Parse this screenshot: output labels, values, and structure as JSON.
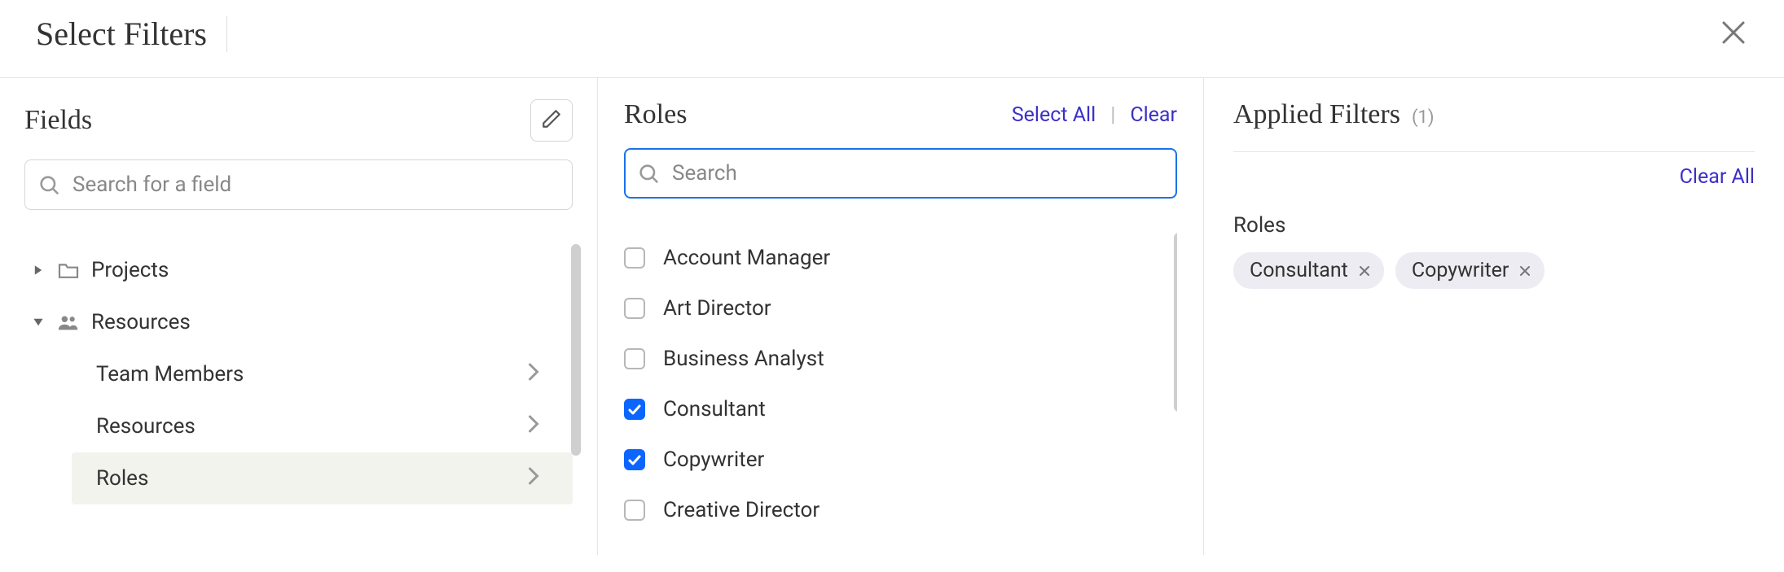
{
  "header": {
    "title": "Select Filters"
  },
  "fields": {
    "title": "Fields",
    "search_placeholder": "Search for a field",
    "tree": {
      "projects": {
        "label": "Projects"
      },
      "resources": {
        "label": "Resources",
        "children": [
          {
            "label": "Team Members",
            "selected": false
          },
          {
            "label": "Resources",
            "selected": false
          },
          {
            "label": "Roles",
            "selected": true
          }
        ]
      }
    }
  },
  "roles": {
    "title": "Roles",
    "select_all_label": "Select All",
    "clear_label": "Clear",
    "search_placeholder": "Search",
    "items": [
      {
        "label": "Account Manager",
        "checked": false
      },
      {
        "label": "Art Director",
        "checked": false
      },
      {
        "label": "Business Analyst",
        "checked": false
      },
      {
        "label": "Consultant",
        "checked": true
      },
      {
        "label": "Copywriter",
        "checked": true
      },
      {
        "label": "Creative Director",
        "checked": false
      }
    ]
  },
  "applied": {
    "title": "Applied Filters",
    "count_display": "(1)",
    "clear_all_label": "Clear All",
    "group_label": "Roles",
    "chips": [
      {
        "label": "Consultant"
      },
      {
        "label": "Copywriter"
      }
    ]
  }
}
